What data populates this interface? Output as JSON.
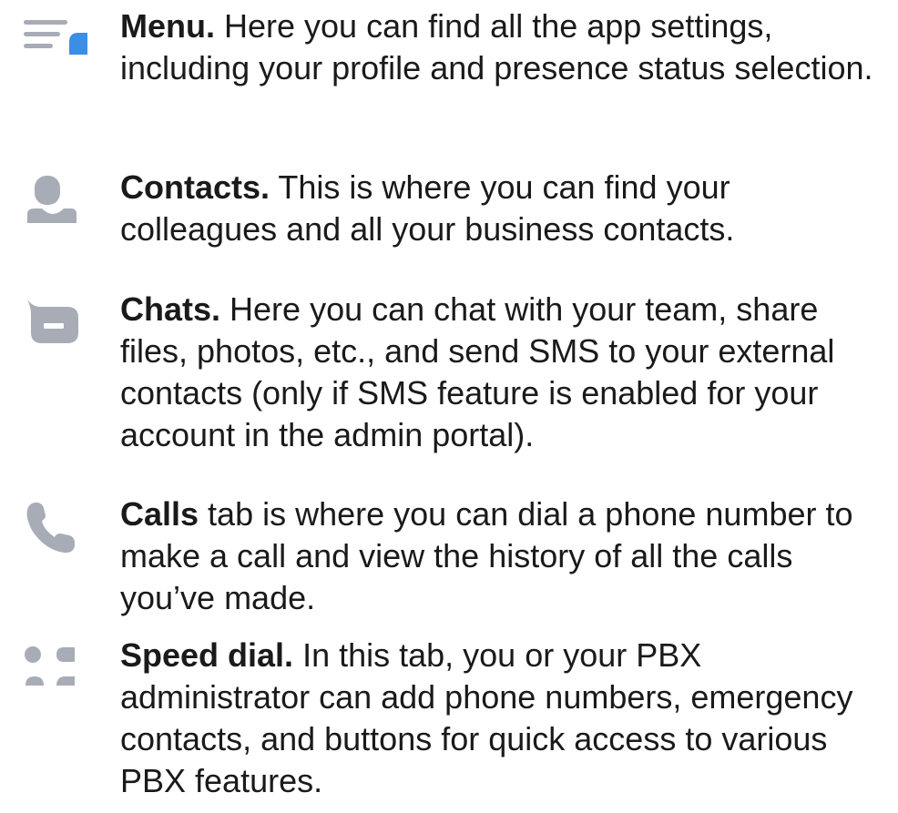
{
  "items": [
    {
      "icon": "menu-icon",
      "title": "Menu.",
      "body": " Here you can find all the app settings, including your profile and presence status selection."
    },
    {
      "icon": "contact-icon",
      "title": "Contacts.",
      "body": " This is where you can find your colleagues and all your business contacts."
    },
    {
      "icon": "chat-icon",
      "title": "Chats.",
      "body": " Here you can chat with your team, share files, photos, etc., and send SMS to your external contacts (only if SMS feature is enabled for your account in the admin portal)."
    },
    {
      "icon": "phone-icon",
      "title": "Calls",
      "body": " tab is where you can dial a phone number to make a call and view the history of all the calls you’ve made."
    },
    {
      "icon": "speed-dial-icon",
      "title": "Speed dial.",
      "body": " In this tab, you or your PBX administrator can add phone numbers, emergency contacts, and buttons for quick access to various PBX features."
    }
  ],
  "colors": {
    "icon_gray": "#a7acb6",
    "accent_blue": "#3a8ee6",
    "text": "#1a1a1a"
  }
}
